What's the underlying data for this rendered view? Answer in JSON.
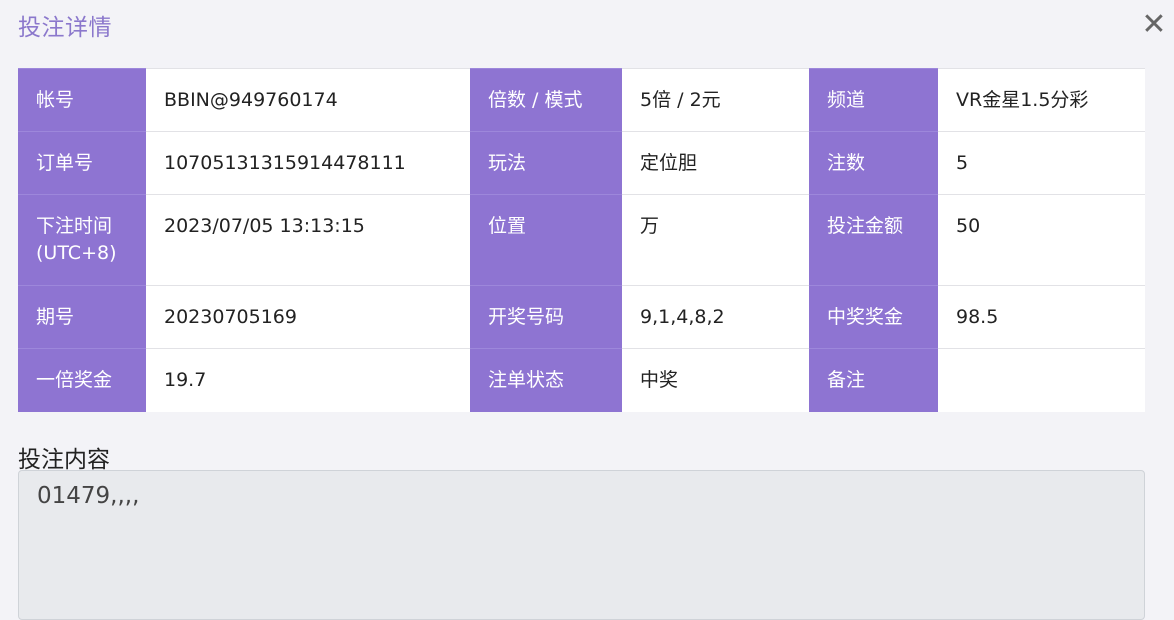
{
  "dialog": {
    "title": "投注详情",
    "close_label": "✕"
  },
  "rows": [
    [
      {
        "label": "帐号",
        "value": "BBIN@949760174"
      },
      {
        "label": "倍数 / 模式",
        "value": "5倍 / 2元"
      },
      {
        "label": "频道",
        "value": "VR金星1.5分彩"
      }
    ],
    [
      {
        "label": "订单号",
        "value": "10705131315914478111"
      },
      {
        "label": "玩法",
        "value": "定位胆"
      },
      {
        "label": "注数",
        "value": "5"
      }
    ],
    [
      {
        "label": "下注时间\n(UTC+8)",
        "value": "2023/07/05 13:13:15"
      },
      {
        "label": "位置",
        "value": "万"
      },
      {
        "label": "投注金额",
        "value": "50"
      }
    ],
    [
      {
        "label": "期号",
        "value": "20230705169"
      },
      {
        "label": "开奖号码",
        "value": "9,1,4,8,2"
      },
      {
        "label": "中奖奖金",
        "value": "98.5"
      }
    ],
    [
      {
        "label": "一倍奖金",
        "value": "19.7"
      },
      {
        "label": "注单状态",
        "value": "中奖"
      },
      {
        "label": "备注",
        "value": ""
      }
    ]
  ],
  "bet_content": {
    "label": "投注内容",
    "value": "01479,,,,"
  }
}
